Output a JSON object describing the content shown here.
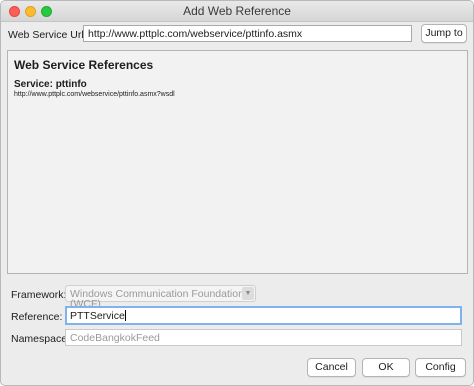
{
  "window": {
    "title": "Add Web Reference"
  },
  "url_row": {
    "label": "Web Service Url:",
    "value": "http://www.pttplc.com/webservice/pttinfo.asmx",
    "jump_button": "Jump to"
  },
  "references": {
    "heading": "Web Service References",
    "service_name": "Service: pttinfo",
    "service_url": "http://www.pttplc.com/webservice/pttinfo.asmx?wsdl"
  },
  "form": {
    "framework_label": "Framework:",
    "framework_value": "Windows Communication Foundation (WCF)",
    "reference_label": "Reference:",
    "reference_value": "PTTService",
    "namespace_label": "Namespace:",
    "namespace_placeholder": "CodeBangkokFeed"
  },
  "buttons": {
    "cancel": "Cancel",
    "ok": "OK",
    "config": "Config"
  },
  "icons": {
    "window_close": "close-icon",
    "window_minimize": "minimize-icon",
    "window_maximize": "maximize-icon",
    "dropdown": "chevron-down-icon"
  },
  "colors": {
    "close": "#fc5f57",
    "minimize": "#fdbc2e",
    "maximize": "#28c840",
    "focus_ring": "#7fb3ef"
  }
}
